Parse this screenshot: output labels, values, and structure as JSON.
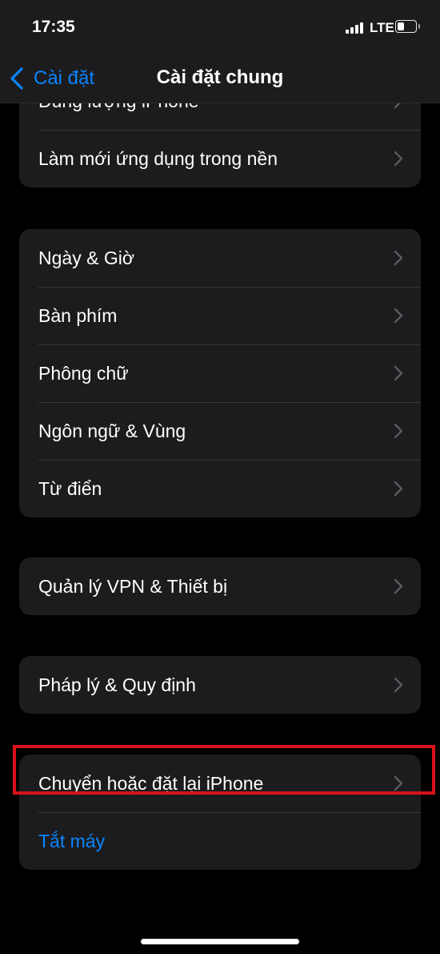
{
  "status": {
    "time": "17:35",
    "network": "LTE"
  },
  "nav": {
    "back_label": "Cài đặt",
    "title": "Cài đặt chung"
  },
  "groups": [
    {
      "items": [
        {
          "label": "Dung lượng iPhone"
        },
        {
          "label": "Làm mới ứng dụng trong nền"
        }
      ]
    },
    {
      "items": [
        {
          "label": "Ngày & Giờ"
        },
        {
          "label": "Bàn phím"
        },
        {
          "label": "Phông chữ"
        },
        {
          "label": "Ngôn ngữ & Vùng"
        },
        {
          "label": "Từ điển"
        }
      ]
    },
    {
      "items": [
        {
          "label": "Quản lý VPN & Thiết bị"
        }
      ]
    },
    {
      "items": [
        {
          "label": "Pháp lý & Quy định"
        }
      ]
    },
    {
      "items": [
        {
          "label": "Chuyển hoặc đặt lại iPhone"
        },
        {
          "label": "Tắt máy"
        }
      ]
    }
  ],
  "colors": {
    "accent": "#0a84ff",
    "highlight": "#d8121c",
    "cell_bg": "#1c1c1e"
  },
  "icons": [
    "back-chevron-icon",
    "chevron-right-icon",
    "signal-icon",
    "battery-icon"
  ]
}
